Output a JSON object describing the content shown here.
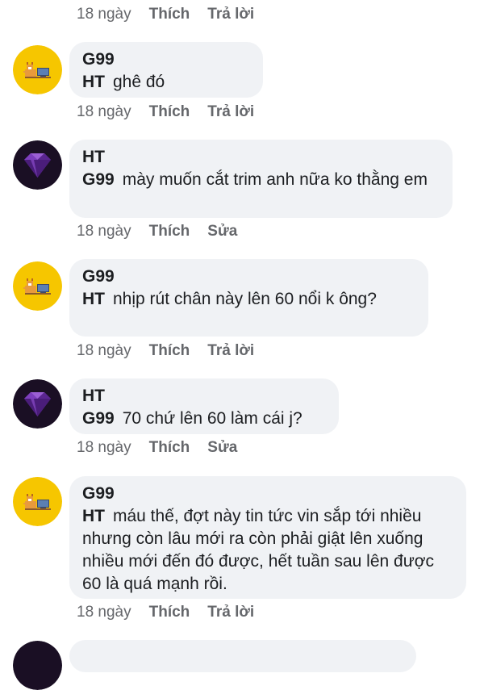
{
  "comments": [
    {
      "time": "18 ngày",
      "actions": [
        "Thích",
        "Trả lời"
      ]
    },
    {
      "author": "G99",
      "tag": "HT",
      "text": "ghê đó",
      "time": "18 ngày",
      "actions": [
        "Thích",
        "Trả lời"
      ]
    },
    {
      "author": "HT",
      "tag": "G99",
      "text": "mày muốn cắt trim anh nữa ko thằng em",
      "time": "18 ngày",
      "actions": [
        "Thích",
        "Sửa"
      ]
    },
    {
      "author": "G99",
      "tag": "HT",
      "text": "nhịp rút chân này lên 60 nổi k ông?",
      "time": "18 ngày",
      "actions": [
        "Thích",
        "Trả lời"
      ]
    },
    {
      "author": "HT",
      "tag": "G99",
      "text": "70 chứ lên 60 làm cái j?",
      "time": "18 ngày",
      "actions": [
        "Thích",
        "Sửa"
      ]
    },
    {
      "author": "G99",
      "tag": "HT",
      "text": "máu thế, đợt này tin tức vin sắp tới nhiều nhưng còn lâu mới ra còn phải giật lên xuống nhiều mới đến đó được, hết tuần sau lên được 60 là quá mạnh rồi.",
      "time": "18 ngày",
      "actions": [
        "Thích",
        "Trả lời"
      ]
    }
  ],
  "colors": {
    "bubble": "#f0f2f5",
    "meta_text": "#65676b",
    "avatar_g99_bg": "#f6c600",
    "avatar_ht_bg": "#1a0f24",
    "avatar_ht_gem": "#6a2fa3"
  },
  "icons": {
    "g99_avatar": "corgi-with-computer-icon",
    "ht_avatar": "purple-diamond-icon"
  }
}
